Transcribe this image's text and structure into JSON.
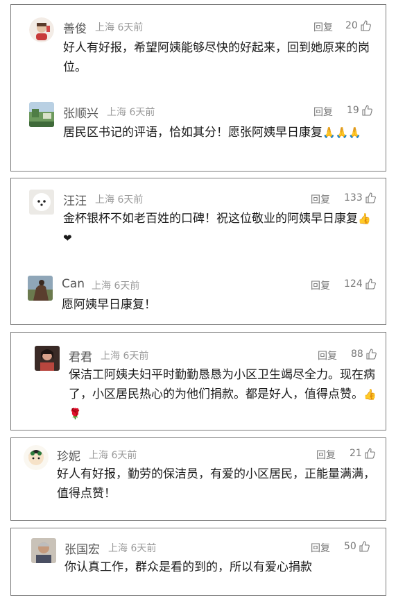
{
  "ui": {
    "reply_label": "回复"
  },
  "comments": [
    {
      "name": "善俊",
      "meta": "上海 6天前",
      "likes": "20",
      "text": "好人有好报，希望阿姨能够尽快的好起来，回到她原来的岗位。",
      "avatar_color": "#e8d6c8"
    },
    {
      "name": "张顺兴",
      "meta": "上海 6天前",
      "likes": "19",
      "text": "居民区书记的评语，恰如其分！愿张阿姨早日康复",
      "emoji_suffix": "🙏🙏🙏",
      "avatar_color": "#7ba07a"
    },
    {
      "name": "汪汪",
      "meta": "上海 6天前",
      "likes": "133",
      "text": "金杯银杯不如老百姓的口碑！祝这位敬业的阿姨早日康复",
      "emoji_suffix": "👍❤",
      "avatar_color": "#f2efe8"
    },
    {
      "name": "Can",
      "meta": "上海 6天前",
      "likes": "124",
      "text": "愿阿姨早日康复！",
      "avatar_color": "#6b5a4c"
    },
    {
      "name": "君君",
      "meta": "上海 6天前",
      "likes": "88",
      "text": "保洁工阿姨夫妇平时勤勤恳恳为小区卫生竭尽全力。现在病了，小区居民热心的为他们捐款。都是好人，值得点赞。",
      "emoji_suffix": "👍🌹",
      "avatar_color": "#8a5a4a"
    },
    {
      "name": "珍妮",
      "meta": "上海 6天前",
      "likes": "21",
      "text": "好人有好报，勤劳的保洁员，有爱的小区居民，正能量满满，值得点赞！",
      "avatar_color": "#f5f2ea"
    },
    {
      "name": "张国宏",
      "meta": "上海 6天前",
      "likes": "50",
      "text": "你认真工作，群众是看的到的，所以有爱心捐款",
      "avatar_color": "#9c8a7a"
    }
  ]
}
